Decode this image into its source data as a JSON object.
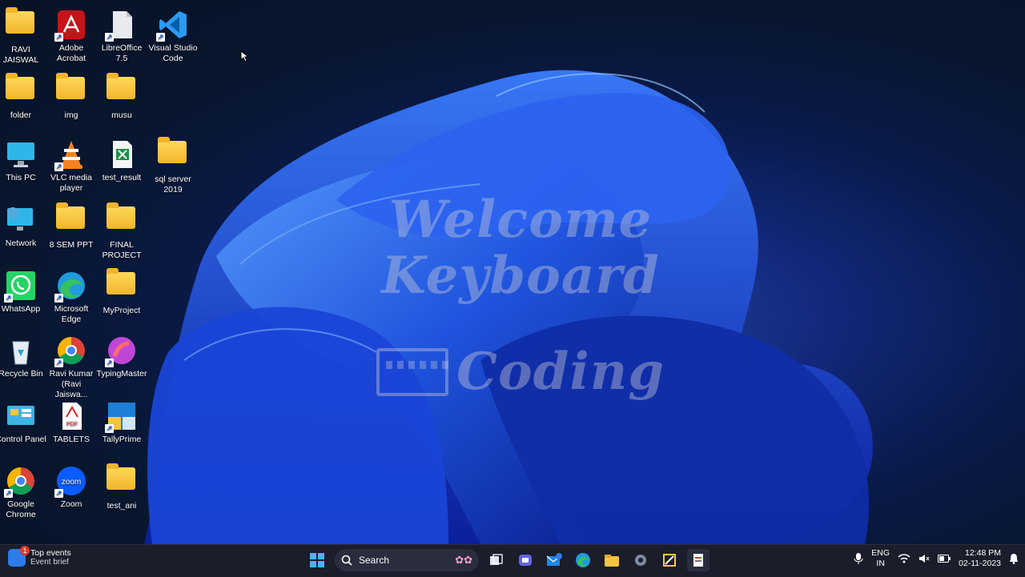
{
  "desktop": {
    "icons": [
      {
        "label": "RAVI JAISWAL",
        "icon": "user-folder-icon"
      },
      {
        "label": "Adobe Acrobat",
        "icon": "acrobat-icon"
      },
      {
        "label": "LibreOffice 7.5",
        "icon": "libreoffice-icon"
      },
      {
        "label": "Visual Studio Code",
        "icon": "vscode-icon"
      },
      {
        "label": "folder",
        "icon": "folder-icon"
      },
      {
        "label": "img",
        "icon": "folder-icon"
      },
      {
        "label": "musu",
        "icon": "folder-icon"
      },
      {
        "label": "This PC",
        "icon": "monitor-icon"
      },
      {
        "label": "VLC media player",
        "icon": "vlc-icon"
      },
      {
        "label": "test_result",
        "icon": "excel-file-icon"
      },
      {
        "label": "sql server 2019",
        "icon": "folder-icon"
      },
      {
        "label": "Network",
        "icon": "network-icon"
      },
      {
        "label": "8 SEM PPT",
        "icon": "folder-icon"
      },
      {
        "label": "FINAL PROJECT",
        "icon": "folder-icon"
      },
      {
        "label": "WhatsApp",
        "icon": "whatsapp-icon"
      },
      {
        "label": "Microsoft Edge",
        "icon": "edge-icon"
      },
      {
        "label": "MyProject",
        "icon": "folder-icon"
      },
      {
        "label": "Recycle Bin",
        "icon": "recycle-bin-icon"
      },
      {
        "label": "Ravi Kumar (Ravi Jaiswa...",
        "icon": "chrome-profile-icon"
      },
      {
        "label": "TypingMaster",
        "icon": "typingmaster-icon"
      },
      {
        "label": "Control Panel",
        "icon": "control-panel-icon"
      },
      {
        "label": "TABLETS",
        "icon": "pdf-file-icon"
      },
      {
        "label": "TallyPrime",
        "icon": "tallyprime-icon"
      },
      {
        "label": "Google Chrome",
        "icon": "chrome-icon"
      },
      {
        "label": "Zoom",
        "icon": "zoom-icon"
      },
      {
        "label": "test_ani",
        "icon": "folder-icon"
      }
    ],
    "watermark": {
      "line1": "Welcome Keyboard",
      "line2": "Coding"
    }
  },
  "taskbar": {
    "widget": {
      "title": "Top events",
      "subtitle": "Event brief",
      "badge": "1"
    },
    "search_label": "Search",
    "pinned": [
      "start-icon",
      "search-icon",
      "flowers-icon",
      "task-view-icon",
      "teams-icon",
      "mail-icon",
      "edge-icon",
      "file-explorer-icon",
      "settings-icon",
      "snipping-icon",
      "app-icon"
    ],
    "lang": {
      "line1": "ENG",
      "line2": "IN"
    },
    "clock": {
      "time": "12:48 PM",
      "date": "02-11-2023"
    }
  },
  "colors": {
    "accent": "#2b7de9",
    "taskbar": "#1b1d2a",
    "folder": "#f1b52c"
  }
}
